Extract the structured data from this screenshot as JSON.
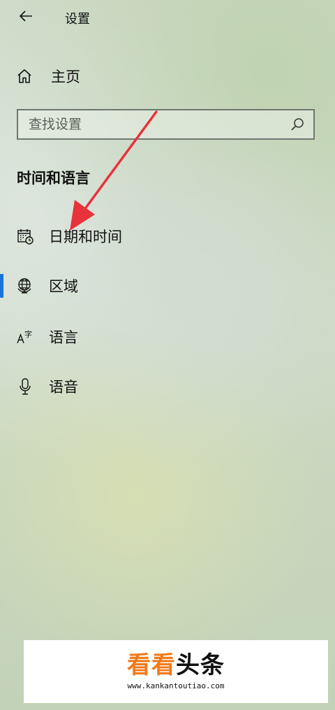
{
  "window": {
    "title": "设置"
  },
  "nav": {
    "home_label": "主页",
    "search_placeholder": "查找设置",
    "section_title": "时间和语言",
    "items": [
      {
        "label": "日期和时间",
        "icon": "calendar-clock-icon",
        "selected": false
      },
      {
        "label": "区域",
        "icon": "globe-icon",
        "selected": true
      },
      {
        "label": "语言",
        "icon": "language-icon",
        "selected": false
      },
      {
        "label": "语音",
        "icon": "microphone-icon",
        "selected": false
      }
    ]
  },
  "annotation": {
    "arrow_color": "#e8323c"
  },
  "watermark": {
    "brand_part1": "看看",
    "brand_part2": "头条",
    "url": "www.kankantoutiao.com",
    "brand_color": "#f07a1a"
  },
  "colors": {
    "accent": "#1a73d9"
  }
}
